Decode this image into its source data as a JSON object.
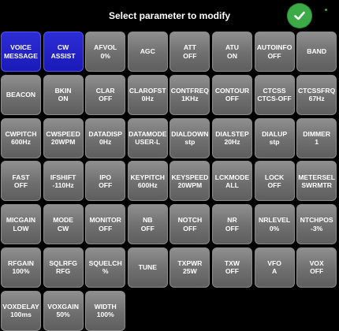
{
  "header": {
    "title": "Select parameter to modify"
  },
  "colors": {
    "confirm": "#3cab47",
    "active_tile": "#1f1fc4",
    "tile": "#777777"
  },
  "tiles": [
    {
      "name": "VOICE",
      "value": "MESSAGE",
      "active": true
    },
    {
      "name": "CW",
      "value": "ASSIST",
      "active": true
    },
    {
      "name": "AFVOL",
      "value": "0%"
    },
    {
      "name": "AGC",
      "value": ""
    },
    {
      "name": "ATT",
      "value": "OFF"
    },
    {
      "name": "ATU",
      "value": "ON"
    },
    {
      "name": "AUTOINFO",
      "value": "OFF"
    },
    {
      "name": "BAND",
      "value": ""
    },
    {
      "name": "BEACON",
      "value": ""
    },
    {
      "name": "BKIN",
      "value": "ON"
    },
    {
      "name": "CLAR",
      "value": "OFF"
    },
    {
      "name": "CLAROFST",
      "value": "0Hz"
    },
    {
      "name": "CONTFREQ",
      "value": "1KHz"
    },
    {
      "name": "CONTOUR",
      "value": "OFF"
    },
    {
      "name": "CTCSS",
      "value": "CTCS-OFF"
    },
    {
      "name": "CTCSSFRQ",
      "value": "67Hz"
    },
    {
      "name": "CWPITCH",
      "value": "600Hz"
    },
    {
      "name": "CWSPEED",
      "value": "20WPM"
    },
    {
      "name": "DATADISP",
      "value": "0Hz"
    },
    {
      "name": "DATAMODE",
      "value": "USER-L"
    },
    {
      "name": "DIALDOWN",
      "value": "stp"
    },
    {
      "name": "DIALSTEP",
      "value": "20Hz"
    },
    {
      "name": "DIALUP",
      "value": "stp"
    },
    {
      "name": "DIMMER",
      "value": "1"
    },
    {
      "name": "FAST",
      "value": "OFF"
    },
    {
      "name": "IFSHIFT",
      "value": "-110Hz"
    },
    {
      "name": "IPO",
      "value": "OFF"
    },
    {
      "name": "KEYPITCH",
      "value": "600Hz"
    },
    {
      "name": "KEYSPEED",
      "value": "20WPM"
    },
    {
      "name": "LCKMODE",
      "value": "ALL"
    },
    {
      "name": "LOCK",
      "value": "OFF"
    },
    {
      "name": "METERSEL",
      "value": "SWRMTR"
    },
    {
      "name": "MICGAIN",
      "value": "LOW"
    },
    {
      "name": "MODE",
      "value": "CW"
    },
    {
      "name": "MONITOR",
      "value": "OFF"
    },
    {
      "name": "NB",
      "value": "OFF"
    },
    {
      "name": "NOTCH",
      "value": "OFF"
    },
    {
      "name": "NR",
      "value": "OFF"
    },
    {
      "name": "NRLEVEL",
      "value": "0%"
    },
    {
      "name": "NTCHPOS",
      "value": "-3%"
    },
    {
      "name": "RFGAIN",
      "value": "100%"
    },
    {
      "name": "SQLRFG",
      "value": "RFG"
    },
    {
      "name": "SQUELCH",
      "value": "%"
    },
    {
      "name": "TUNE",
      "value": ""
    },
    {
      "name": "TXPWR",
      "value": "25W"
    },
    {
      "name": "TXW",
      "value": "OFF"
    },
    {
      "name": "VFO",
      "value": "A"
    },
    {
      "name": "VOX",
      "value": "OFF"
    },
    {
      "name": "VOXDELAY",
      "value": "100ms"
    },
    {
      "name": "VOXGAIN",
      "value": "50%"
    },
    {
      "name": "WIDTH",
      "value": "100%"
    }
  ]
}
